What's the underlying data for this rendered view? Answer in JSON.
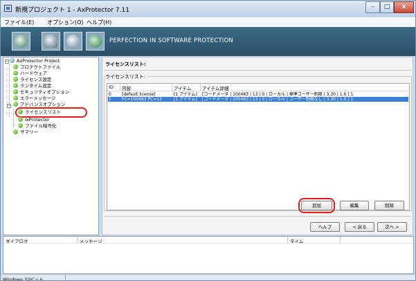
{
  "window": {
    "title": "新規プロジェクト 1 - AxProtector 7.11",
    "minimize": "–",
    "maximize": "□",
    "close": "x"
  },
  "menu": [
    "ファイル(E)",
    "オプション(O)",
    "ヘルプ(H)"
  ],
  "banner": {
    "tagline": "PERFECTION IN SOFTWARE PROTECTION",
    "icons": [
      "project-icon",
      "protect-icon",
      "disc-icon",
      "globe-icon"
    ]
  },
  "tree": {
    "root": "AxProtector Project",
    "items": [
      "プロテクトファイル",
      "ハードウェア",
      "ライセンス設定",
      "ランタイム設定",
      "セキュリティオプション",
      "エラーメッセージ"
    ],
    "advanced": "アドバンスオプション",
    "advanced_children": [
      "ライセンスリスト",
      "IxProtector",
      "ファイル暗号化"
    ],
    "summary": "サマリー",
    "selected": "ライセンスリスト"
  },
  "panel": {
    "heading": "ライセンスリスト:",
    "group_title": "ライセンスリスト:",
    "columns": [
      "ID",
      "内容",
      "アイテム",
      "アイテム詳細"
    ],
    "rows": [
      {
        "id": "0",
        "content": "[default license]",
        "item": "[1 アイテム]",
        "detail": "[コードメータ | 100463 | 13 | 0 | ローカル | 標準ユーザー制限 | 3.30 | 1.0 ] ];",
        "selected": false
      },
      {
        "id": "1",
        "content": "FC=100463 PC=13",
        "item": "[1 アイテム]",
        "detail": "[コードメータ | 100463 | 13 | 0 | ローカル | ユーザー制限なし | 3.30 | 1.0 ] ];",
        "selected": true
      }
    ],
    "buttons": {
      "add": "追加",
      "edit": "編集",
      "delete": "削除"
    }
  },
  "wizard": {
    "help": "ヘルプ",
    "back": "< 戻る",
    "next": "次へ >"
  },
  "log": {
    "columns": [
      "ダイアログ",
      "メッセージ",
      "タイム"
    ]
  },
  "status": {
    "text": "Windows 32ビット"
  },
  "colors": {
    "highlight_ring": "#e11c1c",
    "selection": "#3b7ed3",
    "banner": "#2f566f"
  }
}
